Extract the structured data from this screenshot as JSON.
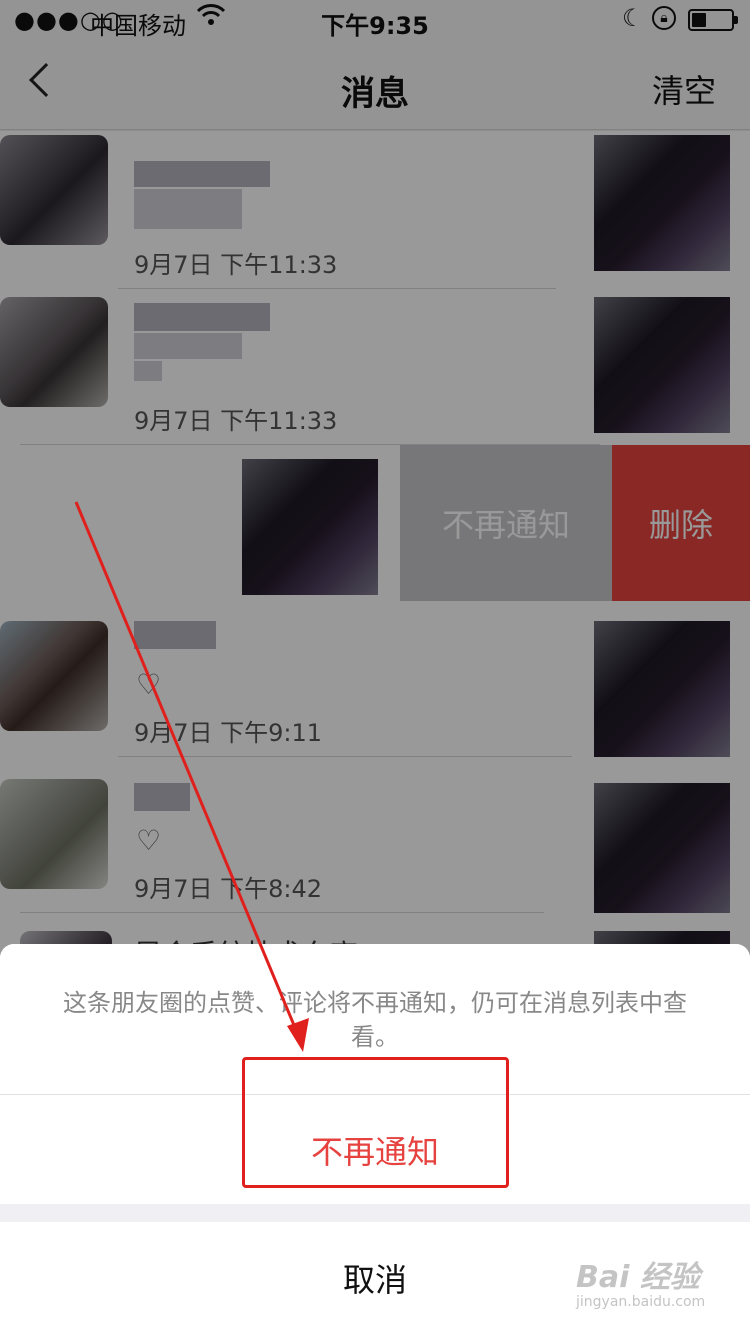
{
  "status_bar": {
    "signal": "●●●○○",
    "carrier": "中国移动",
    "time": "下午9:35"
  },
  "nav": {
    "title": "消息",
    "clear_label": "清空"
  },
  "rows": [
    {
      "time": "9月7日 下午11:33"
    },
    {
      "time": "9月7日 下午11:33"
    },
    {
      "swipe_mute_label": "不再通知",
      "swipe_delete_label": "删除"
    },
    {
      "time": "9月7日 下午9:11"
    },
    {
      "time": "9月7日 下午8:42"
    },
    {
      "preview": "早会系统技术东高"
    }
  ],
  "sheet": {
    "message": "这条朋友圈的点赞、评论将不再通知，仍可在消息列表中查看。",
    "mute_label": "不再通知",
    "cancel_label": "取消"
  },
  "watermark": {
    "main": "Bai 经验",
    "sub": "jingyan.baidu.com"
  },
  "colors": {
    "accent_red": "#e64340",
    "annotation_red": "#e0201c"
  }
}
